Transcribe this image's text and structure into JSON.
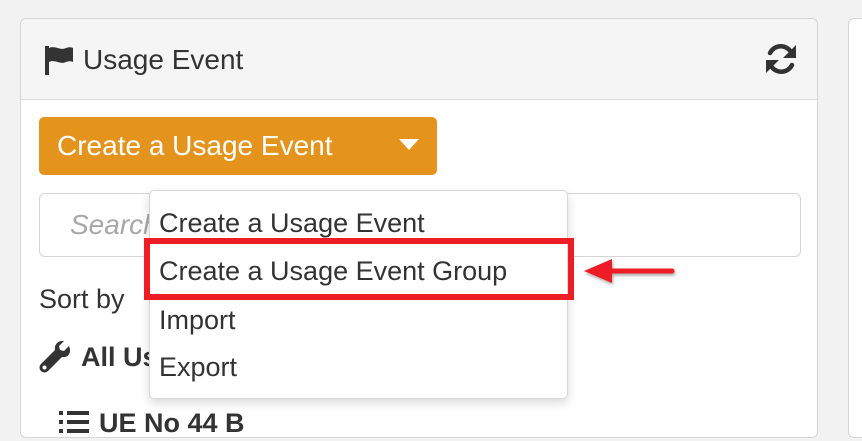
{
  "panel": {
    "title": "Usage Event",
    "header_icon": "flag-icon",
    "refresh_icon": "refresh-icon"
  },
  "create_button": {
    "label": "Create a Usage Event",
    "caret_icon": "caret-down-icon",
    "color": "#e4941c"
  },
  "search": {
    "placeholder": "Search"
  },
  "sort": {
    "label": "Sort by"
  },
  "filter": {
    "icon": "wrench-icon",
    "label": "All Us"
  },
  "list_row": {
    "icon": "list-icon",
    "label": "UE No 44  B"
  },
  "dropdown": {
    "items": [
      {
        "label": "Create a Usage Event"
      },
      {
        "label": "Create a Usage Event Group"
      },
      {
        "label": "Import"
      },
      {
        "label": "Export"
      }
    ]
  },
  "annotation": {
    "highlight_color": "#ee1c25",
    "arrow_icon": "arrow-left-icon"
  }
}
